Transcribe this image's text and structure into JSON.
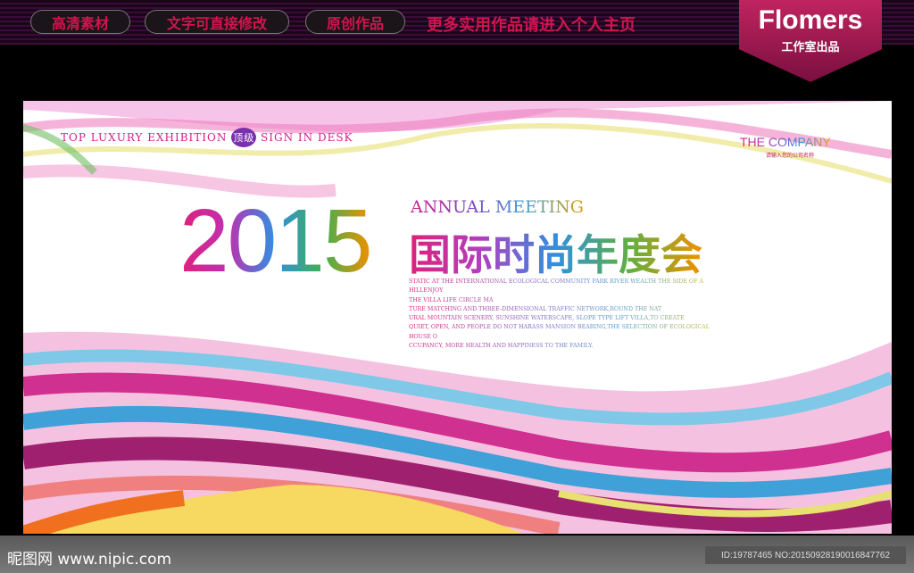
{
  "header": {
    "buttons": [
      "高清素材",
      "文字可直接修改",
      "原创作品"
    ],
    "promo": "更多实用作品请进入个人主页",
    "brand": "Flomers",
    "brand_sub": "工作室出品"
  },
  "poster": {
    "top_left": "TOP LUXURY EXHIBITION",
    "top_badge": "顶级",
    "top_right": "SIGN IN DESK",
    "company": "THE COMPANY",
    "company_sub": "请输入您的公司名称",
    "year": "2015",
    "subtitle": "ANNUAL MEETING",
    "title_cn": "国际时尚年度会",
    "body_lines": [
      "STATIC AT THE INTERNATIONAL ECOLOGICAL COMMUNITY PARK RIVER WEALTH THE SIDE OF A HILLENJOY",
      "THE VILLA LIFE CIRCLE MA",
      "TURE MATCHING AND THREE-DIMENSIONAL TRAFFIC NETWORK,ROUND THE NAT",
      "URAL MOUNTAIN SCENERY, SUNSHINE WATERSCAPE, SLOPE TYPE LIFT VILLA,TO CREATE",
      "QUIET, OPEN, AND PEOPLE DO NOT HARASS MANSION BEARING,THE SELECTION OF ECOLOGICAL HOUSE O",
      "CCUPANCY, MORE HEALTH AND HAPPINESS TO THE FAMILY."
    ]
  },
  "footer": {
    "logo": "昵图网 www.nipic.com",
    "id": "ID:19787465 NO:20150928190016847762"
  }
}
